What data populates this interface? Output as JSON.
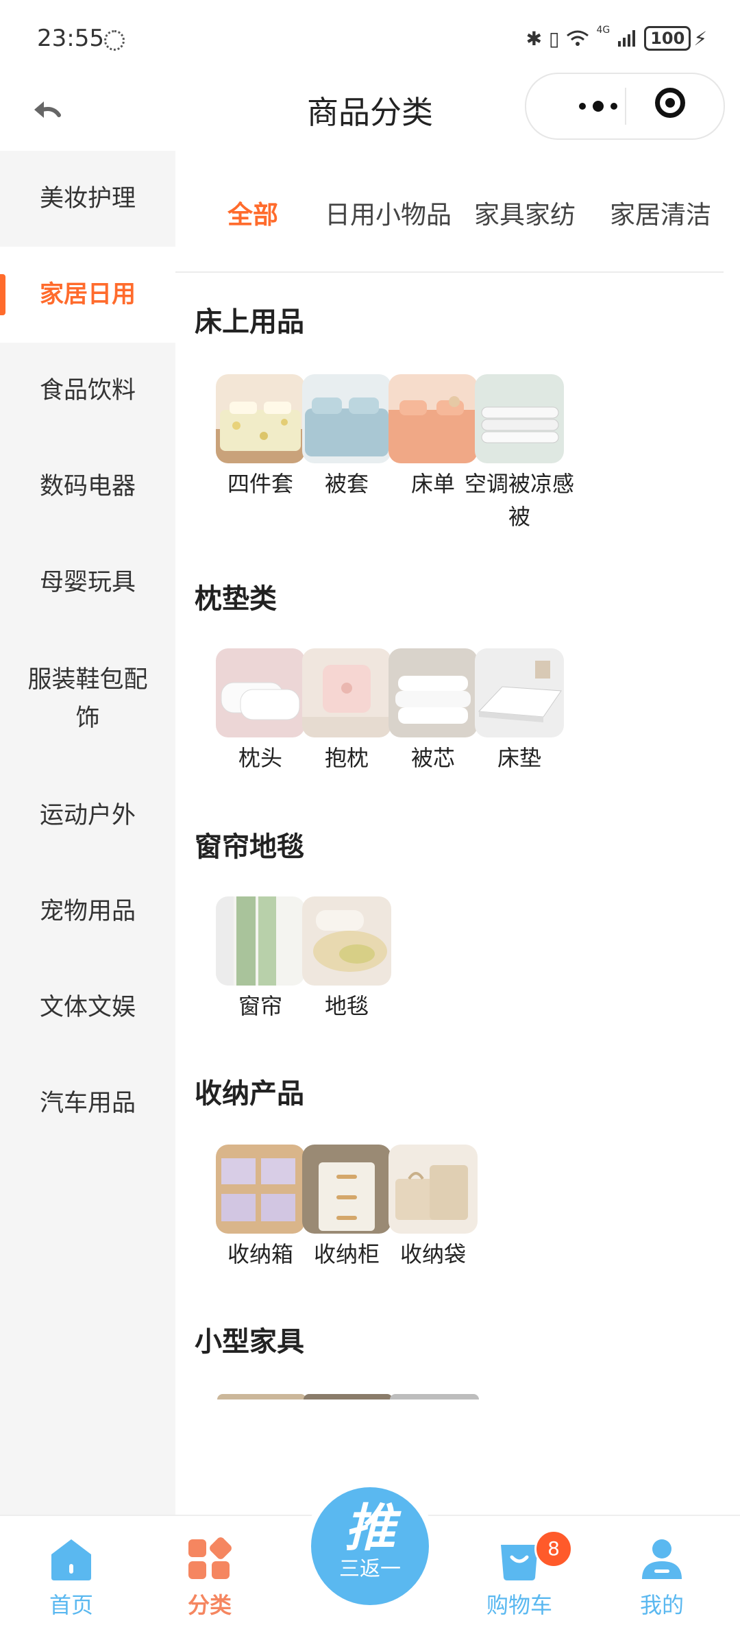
{
  "status_bar": {
    "time": "23:55",
    "signal": "4G",
    "battery": "100"
  },
  "nav": {
    "title": "商品分类"
  },
  "sidebar": {
    "items": [
      {
        "label": "美妆护理"
      },
      {
        "label": "家居日用"
      },
      {
        "label": "食品饮料"
      },
      {
        "label": "数码电器"
      },
      {
        "label": "母婴玩具"
      },
      {
        "label": "服装鞋包配饰"
      },
      {
        "label": "运动户外"
      },
      {
        "label": "宠物用品"
      },
      {
        "label": "文体文娱"
      },
      {
        "label": "汽车用品"
      }
    ],
    "active_index": 1
  },
  "tabs": {
    "items": [
      "全部",
      "日用小物品",
      "家具家纺",
      "家居清洁"
    ],
    "active_index": 0
  },
  "sections": [
    {
      "title": "床上用品",
      "items": [
        "四件套",
        "被套",
        "床单",
        "空调被凉感被"
      ]
    },
    {
      "title": "枕垫类",
      "items": [
        "枕头",
        "抱枕",
        "被芯",
        "床垫"
      ]
    },
    {
      "title": "窗帘地毯",
      "items": [
        "窗帘",
        "地毯"
      ]
    },
    {
      "title": "收纳产品",
      "items": [
        "收纳箱",
        "收纳柜",
        "收纳袋"
      ]
    },
    {
      "title": "小型家具",
      "items": []
    }
  ],
  "tabbar": {
    "home": "首页",
    "category": "分类",
    "center_big": "推",
    "center_small": "三返一",
    "cart": "购物车",
    "cart_badge": "8",
    "mine": "我的"
  },
  "colors": {
    "accent": "#ff6b2c",
    "blue": "#5ab8f0",
    "badge": "#ff5a2a",
    "sidebar_bg": "#f5f5f5"
  }
}
